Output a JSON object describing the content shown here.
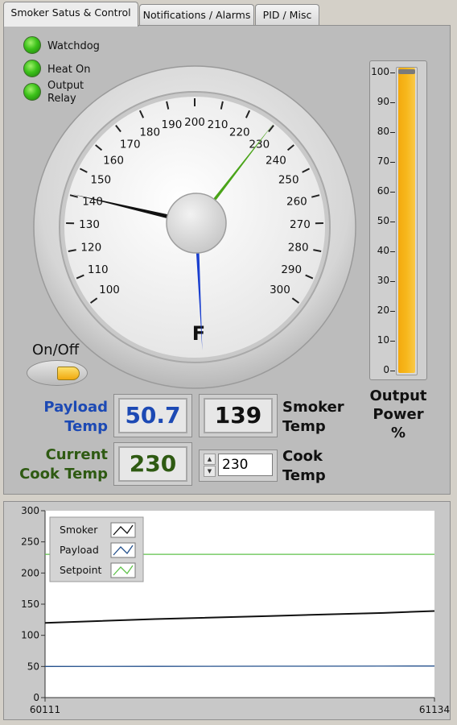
{
  "tabs": [
    {
      "label": "Smoker Satus & Control",
      "active": true
    },
    {
      "label": "Notifications / Alarms",
      "active": false
    },
    {
      "label": "PID / Misc",
      "active": false
    }
  ],
  "indicators": [
    {
      "label": "Watchdog",
      "state": "on",
      "color": "#3cc21a"
    },
    {
      "label": "Heat On",
      "state": "on",
      "color": "#3cc21a"
    },
    {
      "label": "Output Relay",
      "label_lines": [
        "Output",
        "Relay"
      ],
      "state": "on",
      "color": "#3cc21a"
    }
  ],
  "gauge": {
    "unit_label": "F",
    "ticks": [
      "100",
      "110",
      "120",
      "130",
      "140",
      "150",
      "160",
      "170",
      "180",
      "190",
      "200",
      "210",
      "220",
      "230",
      "240",
      "250",
      "260",
      "270",
      "280",
      "290",
      "300"
    ],
    "min": 100,
    "max": 300,
    "needles": [
      {
        "name": "smoker",
        "value": 139,
        "color": "#111111"
      },
      {
        "name": "payload",
        "value": 50.7,
        "color": "#1a3fcf"
      },
      {
        "name": "setpoint",
        "value": 230,
        "color": "#4aa419"
      }
    ]
  },
  "power_bar": {
    "ticks": [
      "100",
      "90",
      "80",
      "70",
      "60",
      "50",
      "40",
      "30",
      "20",
      "10",
      "0"
    ],
    "value_percent": 100,
    "fill_color": "#f7b81c",
    "label_lines": [
      "Output",
      "Power",
      "%"
    ]
  },
  "onoff": {
    "label": "On/Off",
    "state": "on",
    "lamp_color": "#f5c021"
  },
  "payload_temp": {
    "label_lines": [
      "Payload",
      "Temp"
    ],
    "value": "50.7",
    "color": "#1c49b4"
  },
  "smoker_temp": {
    "label_lines": [
      "Smoker",
      "Temp"
    ],
    "value": "139",
    "color": "#111111"
  },
  "current_cook_temp": {
    "label_lines": [
      "Current",
      "Cook Temp"
    ],
    "value": "230",
    "color": "#2e5a12"
  },
  "cook_temp_input": {
    "label_lines": [
      "Cook",
      "Temp"
    ],
    "value": "230"
  },
  "chart_data": {
    "type": "line",
    "xlim": [
      60111,
      61134
    ],
    "ylim": [
      0,
      300
    ],
    "x_ticks": [
      "60111",
      "61134"
    ],
    "y_ticks": [
      "0",
      "50",
      "100",
      "150",
      "200",
      "250",
      "300"
    ],
    "legend_placement": "top-left",
    "series": [
      {
        "name": "Smoker",
        "color": "#111111",
        "x": [
          60111,
          60400,
          60700,
          61000,
          61134
        ],
        "y": [
          120,
          126,
          131,
          136,
          139
        ]
      },
      {
        "name": "Payload",
        "color": "#24508c",
        "x": [
          60111,
          60400,
          60700,
          61000,
          61134
        ],
        "y": [
          50,
          50.2,
          50.4,
          50.6,
          50.7
        ]
      },
      {
        "name": "Setpoint",
        "color": "#5fc24a",
        "x": [
          60111,
          61134
        ],
        "y": [
          230,
          230
        ]
      }
    ]
  }
}
